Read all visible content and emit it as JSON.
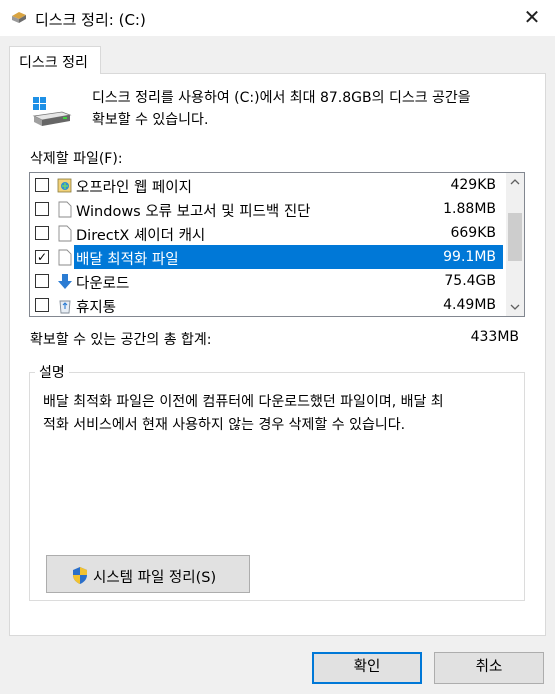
{
  "window": {
    "title": "디스크 정리: (C:)",
    "close_glyph": "✕"
  },
  "tab": {
    "label": "디스크 정리"
  },
  "intro": {
    "line1": "디스크 정리를 사용하여 (C:)에서 최대 87.8GB의 디스크 공간을",
    "line2": "확보할 수 있습니다."
  },
  "files": {
    "label": "삭제할 파일(F):",
    "items": [
      {
        "name": "오프라인 웹 페이지",
        "size": "429KB",
        "checked": false,
        "icon": "offline-pages-icon"
      },
      {
        "name": "Windows 오류 보고서 및 피드백 진단",
        "size": "1.88MB",
        "checked": false,
        "icon": "document-icon"
      },
      {
        "name": "DirectX 셰이더 캐시",
        "size": "669KB",
        "checked": false,
        "icon": "document-icon"
      },
      {
        "name": "배달 최적화 파일",
        "size": "99.1MB",
        "checked": true,
        "selected": true,
        "icon": "document-icon"
      },
      {
        "name": "다운로드",
        "size": "75.4GB",
        "checked": false,
        "icon": "download-arrow-icon"
      },
      {
        "name": "휴지통",
        "size": "4.49MB",
        "checked": false,
        "icon": "recycle-bin-icon"
      }
    ],
    "check_glyph": "✓"
  },
  "total": {
    "label": "확보할 수 있는 공간의 총 합계:",
    "value": "433MB"
  },
  "description": {
    "group_label": "설명",
    "line1": "배달 최적화 파일은 이전에 컴퓨터에 다운로드했던 파일이며, 배달 최",
    "line2": "적화 서비스에서 현재 사용하지 않는 경우 삭제할 수 있습니다."
  },
  "buttons": {
    "system_cleanup": "시스템 파일 정리(S)",
    "ok": "확인",
    "cancel": "취소"
  },
  "colors": {
    "selection": "#0078d7",
    "window_bg": "#f0f0f0",
    "panel_bg": "#ffffff"
  }
}
